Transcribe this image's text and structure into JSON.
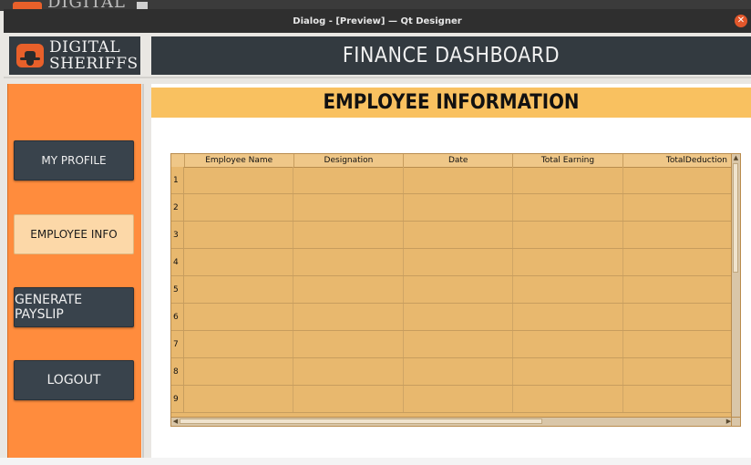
{
  "background_window": {
    "text": "DIGITAL"
  },
  "window": {
    "title": "Dialog - [Preview] — Qt Designer",
    "close_glyph": "✕"
  },
  "header": {
    "brand_line1": "DIGITAL",
    "brand_line2": "SHERIFFS",
    "dashboard_title": "FINANCE DASHBOARD"
  },
  "sidebar": {
    "items": [
      {
        "label": "MY PROFILE",
        "active": false
      },
      {
        "label": "EMPLOYEE  INFO",
        "active": true
      },
      {
        "label": "GENERATE PAYSLIP",
        "active": false
      },
      {
        "label": "LOGOUT",
        "active": false
      }
    ]
  },
  "main": {
    "section_title": "EMPLOYEE INFORMATION",
    "table": {
      "columns": [
        "Employee Name",
        "Designation",
        "Date",
        "Total Earning",
        "TotalDeduction"
      ],
      "row_numbers": [
        "1",
        "2",
        "3",
        "4",
        "5",
        "6",
        "7",
        "8",
        "9"
      ]
    }
  },
  "colors": {
    "sidebar": "#ff8c3d",
    "header_dark": "#333a40",
    "section_banner": "#f9c160",
    "table_body": "#e8b86e"
  },
  "icons": {
    "brand": "sheriff-hat-icon",
    "close": "close-icon",
    "scroll_up": "chevron-up-icon",
    "scroll_left": "chevron-left-icon",
    "scroll_right": "chevron-right-icon"
  }
}
